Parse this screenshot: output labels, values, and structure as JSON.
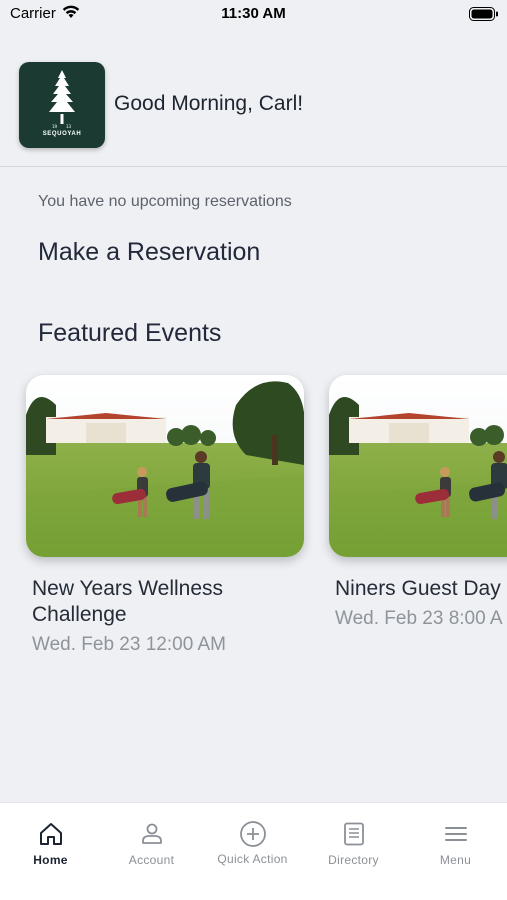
{
  "status_bar": {
    "carrier": "Carrier",
    "time": "11:30 AM"
  },
  "header": {
    "logo_text": "SEQUOYAH",
    "greeting": "Good Morning, Carl!"
  },
  "reservations": {
    "empty_message": "You have no upcoming reservations",
    "make_reservation_label": "Make a Reservation"
  },
  "featured": {
    "heading": "Featured Events",
    "events": [
      {
        "title": "New Years Wellness Challenge",
        "date": "Wed. Feb 23 12:00 AM"
      },
      {
        "title": "Niners Guest Day",
        "date": "Wed. Feb 23 8:00 A"
      }
    ]
  },
  "tabs": [
    {
      "label": "Home",
      "icon": "home-icon",
      "active": true
    },
    {
      "label": "Account",
      "icon": "account-icon",
      "active": false
    },
    {
      "label": "Quick Action",
      "icon": "plus-circle-icon",
      "active": false
    },
    {
      "label": "Directory",
      "icon": "directory-icon",
      "active": false
    },
    {
      "label": "Menu",
      "icon": "menu-icon",
      "active": false
    }
  ],
  "colors": {
    "background": "#eef0f4",
    "logo_green": "#1b3a31",
    "tab_active": "#1c2433",
    "tab_inactive": "#8b9097"
  }
}
